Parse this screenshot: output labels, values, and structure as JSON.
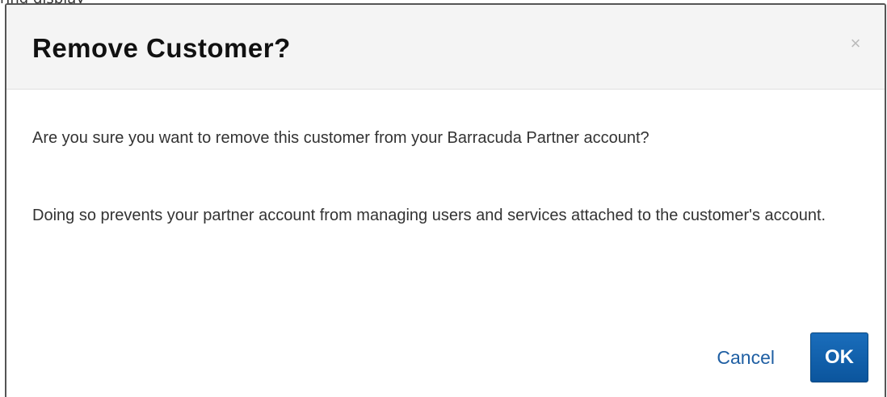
{
  "backdrop": {
    "partial_text": "ring display"
  },
  "dialog": {
    "title": "Remove Customer?",
    "close_glyph": "×",
    "close_icon": "close-icon",
    "paragraphs": [
      "Are you sure you want to remove this customer from your Barracuda Partner account?",
      "Doing so prevents your partner account from managing users and services attached to the customer's account."
    ],
    "cancel_label": "Cancel",
    "ok_label": "OK"
  },
  "colors": {
    "header_bg": "#f4f4f4",
    "link_blue": "#1f5fa3",
    "ok_button": "#0b559d"
  }
}
